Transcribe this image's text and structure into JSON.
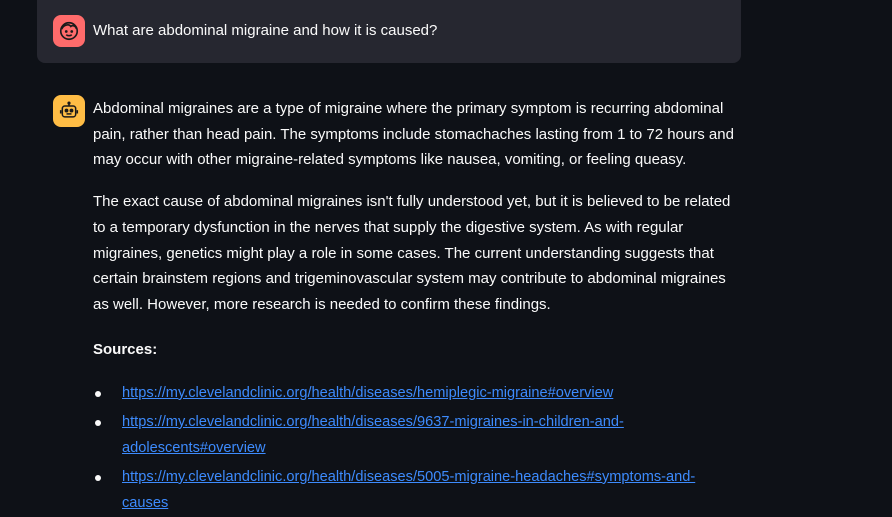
{
  "colors": {
    "background": "#0e1117",
    "user_bubble": "#262730",
    "user_avatar": "#ff6b6b",
    "assistant_avatar": "#ffbd45",
    "link": "#3d8bfd",
    "text": "#fafafa"
  },
  "user_message": {
    "avatar_icon": "user-face-icon",
    "text": "What are abdominal migraine and how it is caused?"
  },
  "assistant_message": {
    "avatar_icon": "robot-icon",
    "paragraphs": [
      "Abdominal migraines are a type of migraine where the primary symptom is recurring abdominal pain, rather than head pain. The symptoms include stomachaches lasting from 1 to 72 hours and may occur with other migraine-related symptoms like nausea, vomiting, or feeling queasy.",
      "The exact cause of abdominal migraines isn't fully understood yet, but it is believed to be related to a temporary dysfunction in the nerves that supply the digestive system. As with regular migraines, genetics might play a role in some cases. The current understanding suggests that certain brainstem regions and trigeminovascular system may contribute to abdominal migraines as well. However, more research is needed to confirm these findings."
    ],
    "sources_heading": "Sources:",
    "sources": [
      "https://my.clevelandclinic.org/health/diseases/hemiplegic-migraine#overview",
      "https://my.clevelandclinic.org/health/diseases/9637-migraines-in-children-and-adolescents#overview",
      "https://my.clevelandclinic.org/health/diseases/5005-migraine-headaches#symptoms-and-causes"
    ]
  }
}
